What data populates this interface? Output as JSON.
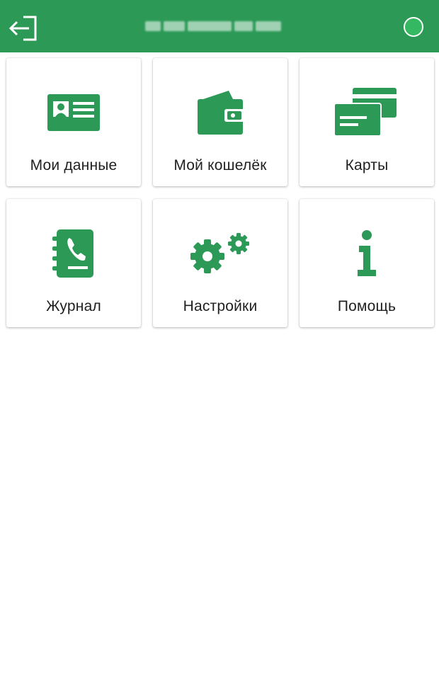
{
  "colors": {
    "header_bg": "#2c9a56",
    "accent": "#2c9a56",
    "status_dot": "#34b862",
    "label_text": "#1f1f1f"
  },
  "header": {
    "logout_icon": "logout-icon",
    "status_icon": "status-indicator-icon"
  },
  "tiles": [
    {
      "label": "Мои данные",
      "icon": "id-card-icon"
    },
    {
      "label": "Мой кошелёк",
      "icon": "wallet-icon"
    },
    {
      "label": "Карты",
      "icon": "cards-icon"
    },
    {
      "label": "Журнал",
      "icon": "phone-book-icon"
    },
    {
      "label": "Настройки",
      "icon": "gears-icon"
    },
    {
      "label": "Помощь",
      "icon": "info-icon"
    }
  ]
}
